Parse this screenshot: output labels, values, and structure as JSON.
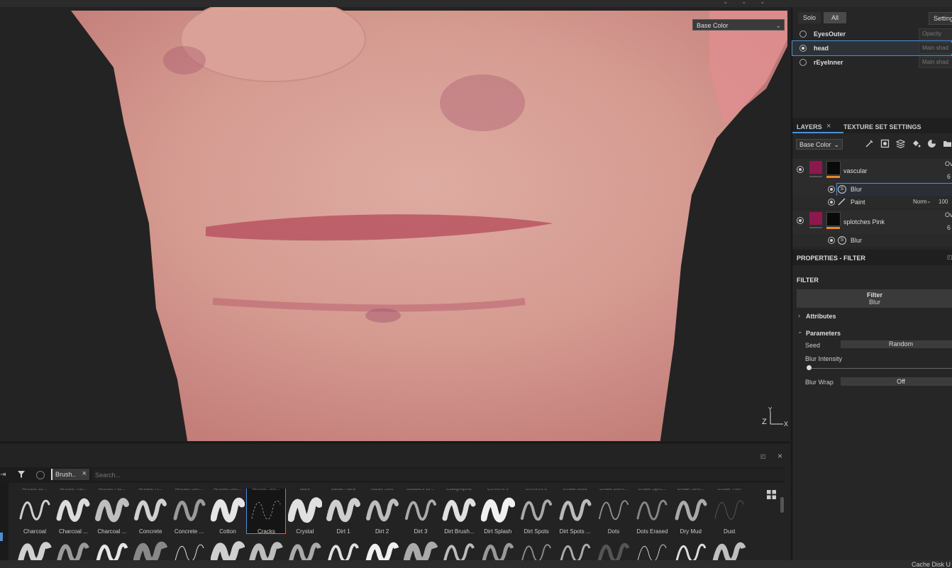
{
  "viewport": {
    "channel_select": "Base Color",
    "axis": {
      "z": "Z",
      "y": "Y",
      "x": "X"
    }
  },
  "texture_sets": {
    "solo_label": "Solo",
    "all_label": "All",
    "settings_label": "Setting",
    "items": [
      {
        "name": "EyesOuter",
        "field": "Opacity",
        "selected": false
      },
      {
        "name": "head",
        "field": "Main shad",
        "selected": true
      },
      {
        "name": "rEyeInner",
        "field": "Main shad",
        "selected": false
      }
    ]
  },
  "layers_panel": {
    "tabs": [
      "LAYERS",
      "TEXTURE SET SETTINGS"
    ],
    "channel": "Base Color",
    "layers": [
      {
        "name": "vascular",
        "blend_short": "Ov",
        "opacity_short": "6"
      },
      {
        "name": "Blur",
        "type": "filter"
      },
      {
        "name": "Paint",
        "type": "paint",
        "blend": "Norm",
        "opacity": "100"
      },
      {
        "name": "splotches Pink",
        "blend_short": "Ov",
        "opacity_short": "6"
      },
      {
        "name": "Blur",
        "type": "filter"
      }
    ]
  },
  "properties": {
    "title": "PROPERTIES - FILTER",
    "section": "FILTER",
    "filter_label": "Filter",
    "filter_value": "Blur",
    "attributes_label": "Attributes",
    "parameters_label": "Parameters",
    "seed_label": "Seed",
    "seed_value": "Random",
    "blur_intensity_label": "Blur Intensity",
    "blur_intensity": 0.0,
    "blur_wrap_label": "Blur Wrap",
    "blur_wrap_value": "Off"
  },
  "shelf": {
    "filter_tag": "Brush..",
    "search_placeholder": "Search...",
    "brushes": [
      "Charcoal",
      "Charcoal ...",
      "Charcoal ...",
      "Concrete",
      "Concrete ...",
      "Cotton",
      "Cracks",
      "Crystal",
      "Dirt 1",
      "Dirt 2",
      "Dirt 3",
      "Dirt Brush...",
      "Dirt Splash",
      "Dirt Spots",
      "Dirt Spots ...",
      "Dots",
      "Dots Erased",
      "Dry Mud",
      "Dust"
    ],
    "selected_brush": "Cracks",
    "top_row_labels": [
      "Artistic Br...",
      "Artistic Ha...",
      "Artistic Ha...",
      "Artistic H...",
      "Artistic Sof...",
      "Artistic Sof...",
      "Artistic Sof...",
      "Bark",
      "Basic Hard",
      "Basic Soft",
      "Bubbles Br...",
      "Calligraphic",
      "Cement 1",
      "Cement 2",
      "Chalk Bold",
      "Chalk Bum...",
      "Chalk Spre...",
      "Chalk Stro...",
      "Chalk Thin"
    ]
  },
  "status": {
    "text": "Cache Disk U"
  },
  "colors": {
    "accent_selection": "#4a90d9",
    "mask_orange": "#e08a2e",
    "layer_magenta": "#8a1a4e"
  }
}
